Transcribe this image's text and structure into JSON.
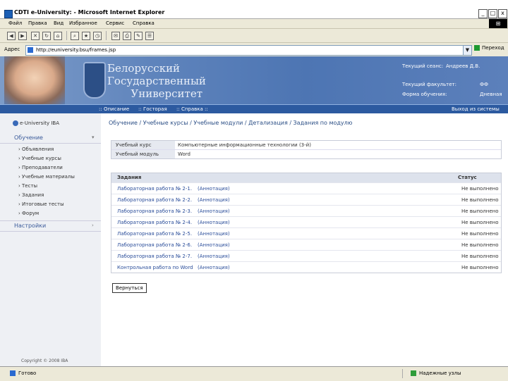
{
  "window": {
    "title": "CDTI e-University: - Microsoft Internet Explorer",
    "min": "_",
    "max": "□",
    "close": "x"
  },
  "menu": [
    "Файл",
    "Правка",
    "Вид",
    "Избранное",
    "Сервис",
    "Справка"
  ],
  "address": {
    "label": "Адрес",
    "url": "http://euniversity.bsu/frames.jsp",
    "go": "Переход"
  },
  "banner": {
    "university": "Белорусский\nГосударственный\n       Университет",
    "user_label": "Текущий сеанс:",
    "user_name": "Андреев Д.В.",
    "current_role_label": "Текущий факультет:",
    "current_role_value": "ФФ",
    "study_form_label": "Форма обучения:",
    "study_form_value": "Дневная"
  },
  "nav": {
    "links": [
      "Описание",
      "Госторая",
      "Справка"
    ],
    "exit": "Выход из системы"
  },
  "sidebar": {
    "brand": "e-University IBA",
    "section_study": "Обучение",
    "items": [
      "Объявления",
      "Учебные курсы",
      "Преподаватели",
      "Учебные материалы",
      "Тесты",
      "Задания",
      "Итоговые тесты",
      "Форум"
    ],
    "section_settings": "Настройки",
    "copyright": "Copyright © 2008 IBA"
  },
  "main": {
    "breadcrumb": "Обучение / Учебные курсы / Учебные модули / Детализация / Задания по модулю",
    "info": [
      {
        "key": "Учебный курс",
        "value": "Компьютерные информационные технологии (3-й)"
      },
      {
        "key": "Учебный модуль",
        "value": "Word"
      }
    ],
    "tasks_header": {
      "name": "Задания",
      "status": "Статус"
    },
    "tasks": [
      {
        "name": "Лабораторная работа № 2-1.",
        "link": "(Аннотация)",
        "status": "Не выполнено"
      },
      {
        "name": "Лабораторная работа № 2-2.",
        "link": "(Аннотация)",
        "status": "Не выполнено"
      },
      {
        "name": "Лабораторная работа № 2-3.",
        "link": "(Аннотация)",
        "status": "Не выполнено"
      },
      {
        "name": "Лабораторная работа № 2-4.",
        "link": "(Аннотация)",
        "status": "Не выполнено"
      },
      {
        "name": "Лабораторная работа № 2-5.",
        "link": "(Аннотация)",
        "status": "Не выполнено"
      },
      {
        "name": "Лабораторная работа № 2-6.",
        "link": "(Аннотация)",
        "status": "Не выполнено"
      },
      {
        "name": "Лабораторная работа № 2-7.",
        "link": "(Аннотация)",
        "status": "Не выполнено"
      },
      {
        "name": "Контрольная работа по Word",
        "link": "(Аннотация)",
        "status": "Не выполнено"
      }
    ],
    "back_button": "Вернуться"
  },
  "status": {
    "left": "Готово",
    "right": "Надежные узлы"
  }
}
